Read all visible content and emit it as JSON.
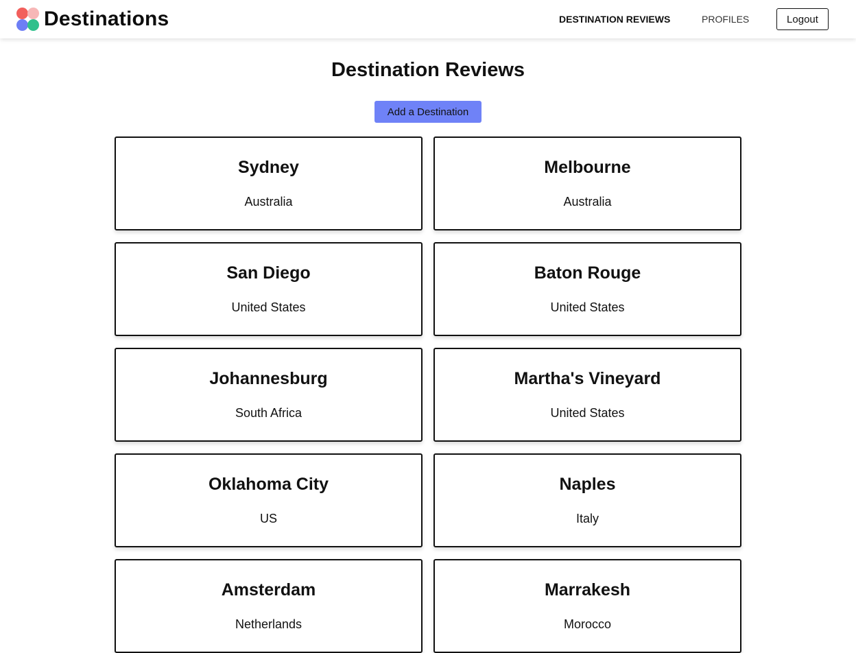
{
  "colors": {
    "logo_red": "#f25f5c",
    "logo_pink": "#f7b7b7",
    "logo_blue": "#6d7ef5",
    "logo_green": "#2fc08c",
    "accent_button": "#6f82f7"
  },
  "header": {
    "brand": "Destinations",
    "nav": {
      "reviews": "DESTINATION REVIEWS",
      "profiles": "PROFILES"
    },
    "logout": "Logout"
  },
  "main": {
    "title": "Destination Reviews",
    "add_button": "Add a Destination",
    "destinations": [
      {
        "city": "Sydney",
        "country": "Australia"
      },
      {
        "city": "Melbourne",
        "country": "Australia"
      },
      {
        "city": "San Diego",
        "country": "United States"
      },
      {
        "city": "Baton Rouge",
        "country": "United States"
      },
      {
        "city": "Johannesburg",
        "country": "South Africa"
      },
      {
        "city": "Martha's Vineyard",
        "country": "United States"
      },
      {
        "city": "Oklahoma City",
        "country": "US"
      },
      {
        "city": "Naples",
        "country": "Italy"
      },
      {
        "city": "Amsterdam",
        "country": "Netherlands"
      },
      {
        "city": "Marrakesh",
        "country": "Morocco"
      }
    ]
  }
}
